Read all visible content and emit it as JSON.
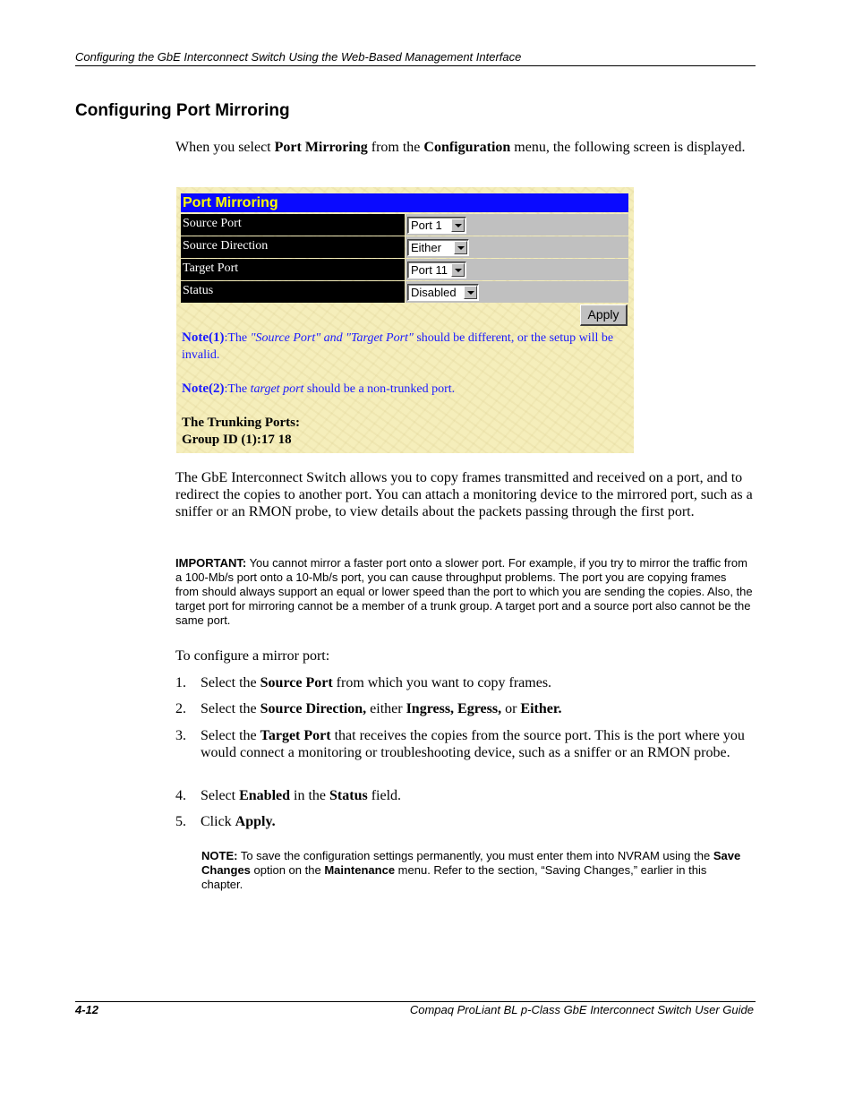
{
  "header": {
    "running_title": "Configuring the GbE Interconnect Switch Using the Web-Based Management Interface"
  },
  "section_title": "Configuring Port Mirroring",
  "intro": {
    "t1": "When you select ",
    "b1": "Port Mirroring",
    "t2": " from the ",
    "b2": "Configuration",
    "t3": " menu, the following screen is displayed."
  },
  "screen": {
    "title": "Port Mirroring",
    "fields": [
      {
        "label": "Source Port",
        "value": "Port 1"
      },
      {
        "label": "Source Direction",
        "value": "Either"
      },
      {
        "label": "Target Port",
        "value": "Port 11"
      },
      {
        "label": "Status",
        "value": "Disabled"
      }
    ],
    "apply_label": "Apply",
    "note1": {
      "prefix": "Note(1)",
      "t1": ":The ",
      "italic": "\"Source Port\" and \"Target Port\"",
      "t2": " should be different, or the setup will be invalid."
    },
    "note2": {
      "prefix": "Note(2)",
      "t1": ":The ",
      "italic": "target port",
      "t2": " should be a non-trunked port."
    },
    "trunk_heading": "The Trunking Ports:",
    "trunk_group": "Group ID (1):17 18"
  },
  "body": {
    "para1": "The GbE Interconnect Switch allows you to copy frames transmitted and received on a port, and to redirect the copies to another port. You can attach a monitoring device to the mirrored port, such as a sniffer or an RMON probe, to view details about the packets passing through the first port.",
    "important_label": "IMPORTANT:",
    "important_text": "  You cannot mirror a faster port onto a slower port. For example, if you try to mirror the traffic from a 100-Mb/s port onto a 10-Mb/s port, you can cause throughput problems. The port you are copying frames from should always support an equal or lower speed than the port to which you are sending the copies. Also, the target port for mirroring cannot be a member of a trunk group. A target port and a source port also cannot be the same port.",
    "configure_intro": "To configure a mirror port:",
    "steps": [
      {
        "num": "1.",
        "t1": "Select the ",
        "b1": "Source Port",
        "t2": " from which you want to copy frames."
      },
      {
        "num": "2.",
        "t1": "Select the ",
        "b1": "Source Direction,",
        "t2": " either ",
        "b2": "Ingress, Egress,",
        "t3": " or ",
        "b3": "Either."
      },
      {
        "num": "3.",
        "t1": "Select the ",
        "b1": "Target Port",
        "t2": " that receives the copies from the source port. This is the port where you would connect a monitoring or troubleshooting device, such as a sniffer or an RMON probe."
      },
      {
        "num": "4.",
        "t1": "Select ",
        "b1": "Enabled",
        "t2": " in the ",
        "b2": "Status",
        "t3": " field."
      },
      {
        "num": "5.",
        "t1": "Click ",
        "b1": "Apply."
      }
    ],
    "note_label": "NOTE:",
    "note_t1": "  To save the configuration settings permanently, you must enter them into NVRAM using the ",
    "note_b1": "Save Changes",
    "note_t2": " option on the ",
    "note_b2": "Maintenance",
    "note_t3": " menu. Refer to the section, “Saving Changes,” earlier in this chapter."
  },
  "footer": {
    "page_number": "4-12",
    "guide_title": "Compaq ProLiant BL p-Class GbE Interconnect Switch User Guide"
  }
}
